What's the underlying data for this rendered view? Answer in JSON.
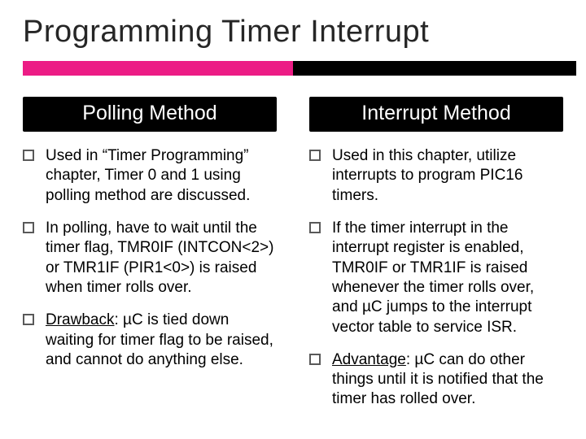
{
  "title": "Programming Timer Interrupt",
  "left": {
    "header": "Polling Method",
    "items": [
      {
        "text": "Used in “Timer Programming” chapter, Timer 0 and 1 using polling method are discussed."
      },
      {
        "text": "In polling, have to wait until the timer flag, TMR0IF (INTCON<2>) or TMR1IF (PIR1<0>) is raised when timer rolls over."
      },
      {
        "lead": "Drawback",
        "rest": ": µC is tied down waiting for timer flag to be raised, and cannot do anything else."
      }
    ]
  },
  "right": {
    "header": "Interrupt Method",
    "items": [
      {
        "text": "Used in this chapter, utilize interrupts to program PIC16 timers."
      },
      {
        "text": "If the timer interrupt in the interrupt register is enabled, TMR0IF or TMR1IF is raised whenever the timer rolls over, and µC jumps to the interrupt vector table to service ISR."
      },
      {
        "lead": "Advantage",
        "rest": ": µC can do other things until it is notified that the timer has rolled over."
      }
    ]
  }
}
